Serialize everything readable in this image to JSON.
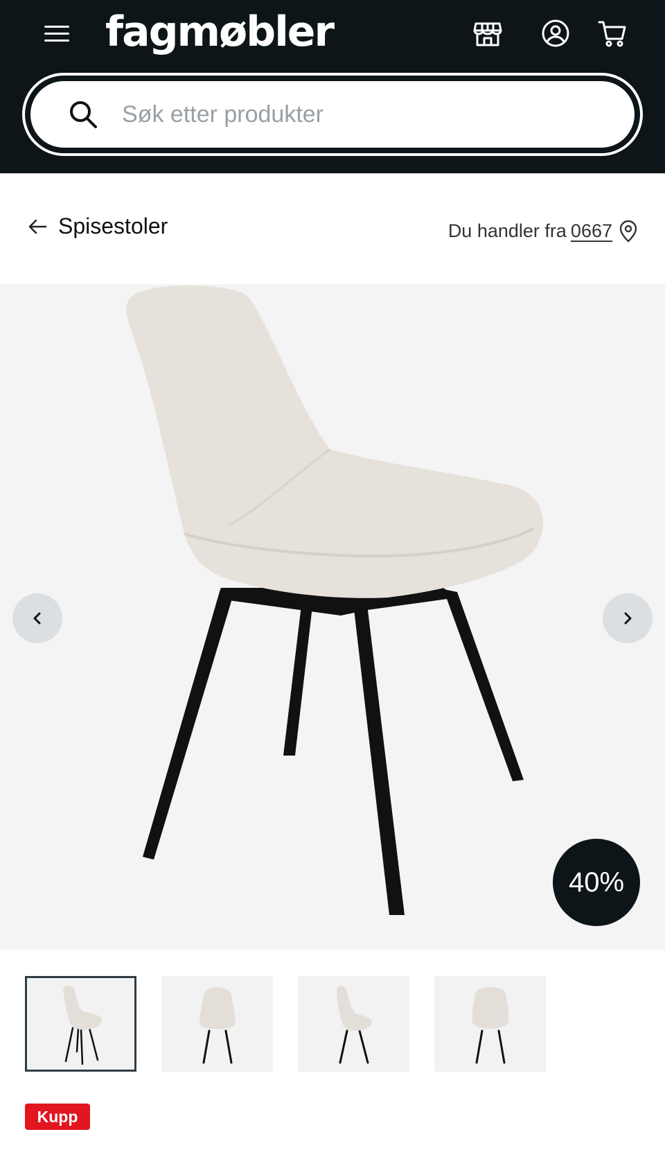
{
  "header": {
    "logo": "fagmøbler",
    "icons": [
      "menu-icon",
      "store-icon",
      "account-icon",
      "cart-icon"
    ]
  },
  "search": {
    "placeholder": "Søk etter produkter"
  },
  "breadcrumb": {
    "back_label": "Spisestoler"
  },
  "store": {
    "prefix": "Du handler fra",
    "code": "0667"
  },
  "gallery": {
    "discount": "40%",
    "thumbnails": [
      {
        "view": "angled",
        "active": true
      },
      {
        "view": "front",
        "active": false
      },
      {
        "view": "side",
        "active": false
      },
      {
        "view": "back",
        "active": false
      }
    ]
  },
  "badge": {
    "label": "Kupp",
    "color": "#e1161f"
  },
  "colors": {
    "header_bg": "#0e1519",
    "gallery_bg": "#f4f4f4",
    "chair_fabric": "#e6e1db",
    "chair_legs": "#111111"
  }
}
